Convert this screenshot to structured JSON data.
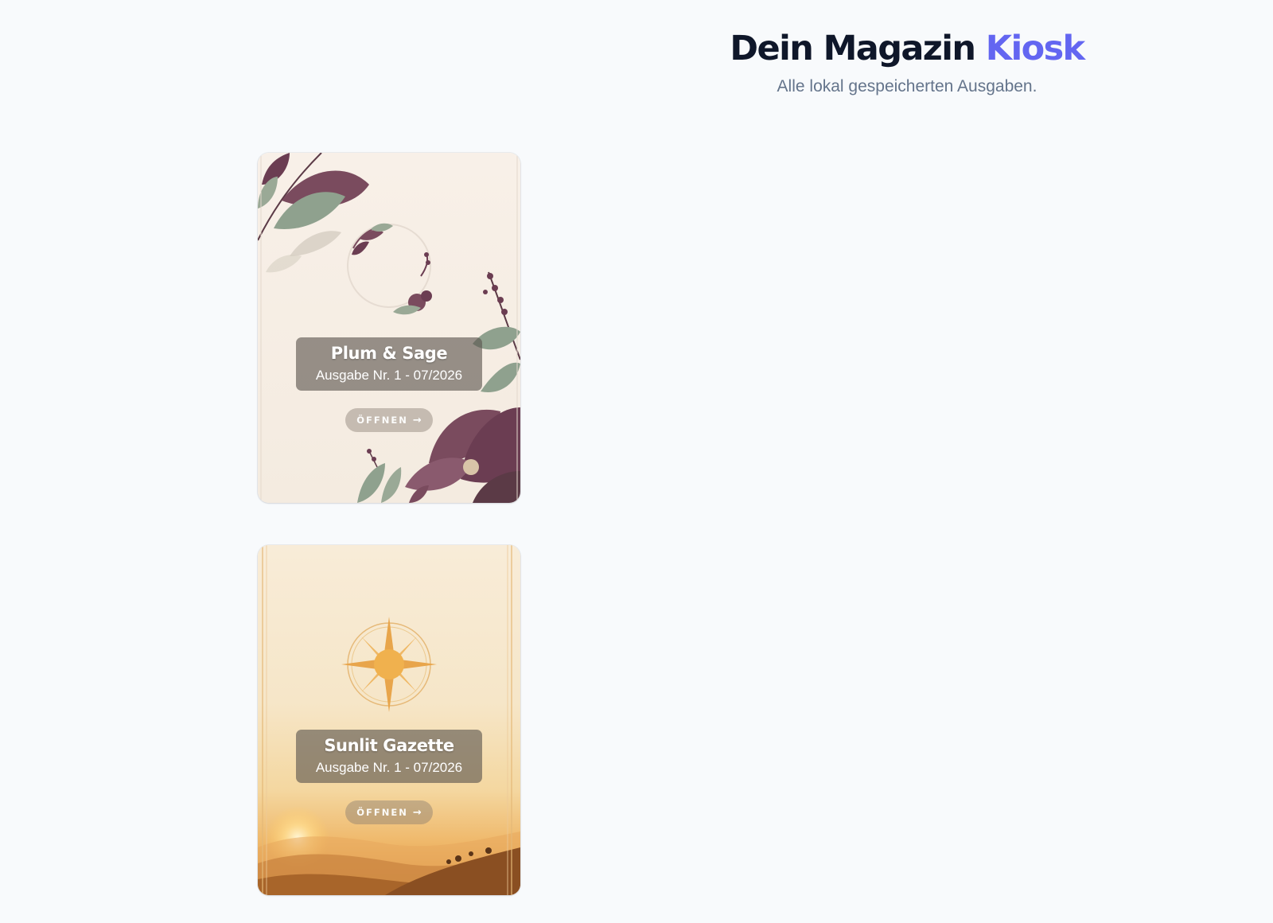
{
  "header": {
    "title_main": "Dein Magazin",
    "title_accent": "Kiosk",
    "subtitle": "Alle lokal gespeicherten Ausgaben."
  },
  "colors": {
    "accent": "#6366f1",
    "title": "#0f172a",
    "subtitle": "#64748b",
    "background": "#f8fafc"
  },
  "magazines": [
    {
      "name": "Plum & Sage",
      "issue": "Ausgabe Nr. 1 - 07/2026",
      "open_label": "ÖFFNEN",
      "arrow_icon": "→",
      "cover": "floral-plum-sage-cover"
    },
    {
      "name": "Sunlit Gazette",
      "issue": "Ausgabe Nr. 1 - 07/2026",
      "open_label": "ÖFFNEN",
      "arrow_icon": "→",
      "cover": "sun-compass-landscape-cover"
    }
  ]
}
